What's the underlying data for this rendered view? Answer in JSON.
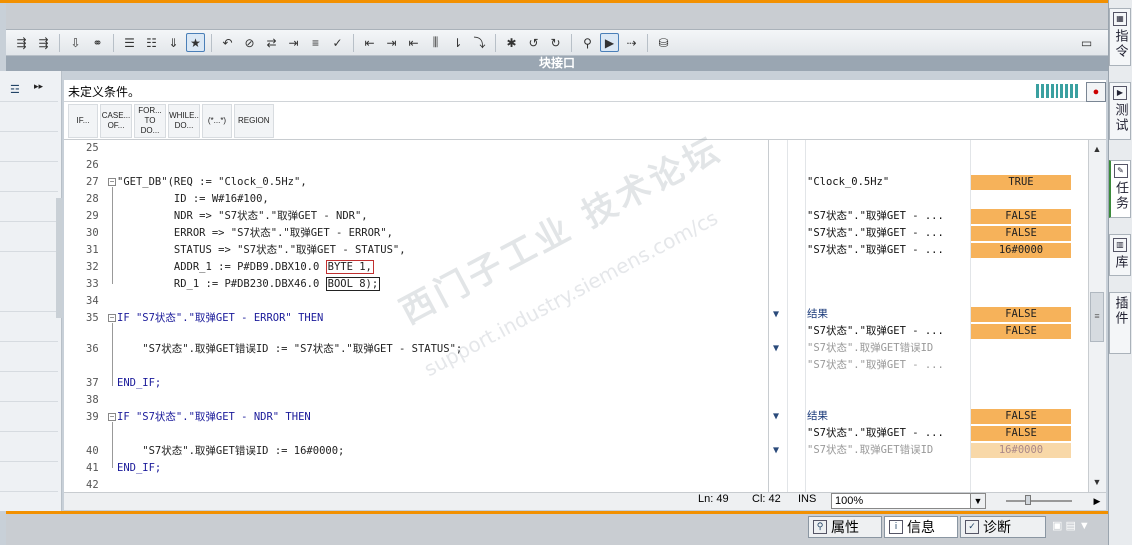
{
  "panel_title": "块接口",
  "condition_text": "未定义条件。",
  "snippets": [
    "IF...",
    "CASE... OF...",
    "FOR... TO DO...",
    "WHILE.. DO...",
    "(*...*)",
    "REGION"
  ],
  "code_lines": [
    {
      "num": "25",
      "text": ""
    },
    {
      "num": "26",
      "text": ""
    },
    {
      "num": "27",
      "text": "\"GET_DB\"(REQ := \"Clock_0.5Hz\","
    },
    {
      "num": "28",
      "text": "         ID := W#16#100,"
    },
    {
      "num": "29",
      "text": "         NDR => \"S7状态\".\"取弹GET - NDR\","
    },
    {
      "num": "30",
      "text": "         ERROR => \"S7状态\".\"取弹GET - ERROR\","
    },
    {
      "num": "31",
      "text": "         STATUS => \"S7状态\".\"取弹GET - STATUS\","
    },
    {
      "num": "32",
      "text": "         ADDR_1 := P#DB9.DBX10.0 "
    },
    {
      "num": "33",
      "text": "         RD_1 := P#DB230.DBX46.0 "
    },
    {
      "num": "34",
      "text": ""
    },
    {
      "num": "35",
      "text": "IF \"S7状态\".\"取弹GET - ERROR\" THEN"
    },
    {
      "num": "36",
      "text": "    \"S7状态\".取弹GET错误ID := \"S7状态\".\"取弹GET - STATUS\";"
    },
    {
      "num": "37",
      "text": "END_IF;"
    },
    {
      "num": "38",
      "text": ""
    },
    {
      "num": "39",
      "text": "IF \"S7状态\".\"取弹GET - NDR\" THEN"
    },
    {
      "num": "40",
      "text": "    \"S7状态\".取弹GET错误ID := 16#0000;"
    },
    {
      "num": "41",
      "text": "END_IF;"
    },
    {
      "num": "42",
      "text": ""
    }
  ],
  "boxed": {
    "addr_type": "BYTE 1,",
    "rd_type": "BOOL 8);"
  },
  "monitor": [
    {
      "name": "\"Clock_0.5Hz\"",
      "value": "TRUE"
    },
    {
      "name": "\"S7状态\".\"取弹GET - ...",
      "value": "FALSE"
    },
    {
      "name": "\"S7状态\".\"取弹GET - ...",
      "value": "FALSE"
    },
    {
      "name": "\"S7状态\".\"取弹GET - ...",
      "value": "16#0000"
    },
    {
      "name": "结果",
      "value": "FALSE"
    },
    {
      "name": "\"S7状态\".\"取弹GET - ...",
      "value": "FALSE"
    },
    {
      "name": "\"S7状态\".取弹GET错误ID",
      "value": ""
    },
    {
      "name": "\"S7状态\".\"取弹GET - ...",
      "value": ""
    },
    {
      "name": "结果",
      "value": "FALSE"
    },
    {
      "name": "\"S7状态\".\"取弹GET - ...",
      "value": "FALSE"
    },
    {
      "name": "\"S7状态\".取弹GET错误ID",
      "value": "16#0000"
    }
  ],
  "status": {
    "ln": "Ln: 49",
    "cl": "Cl: 42",
    "ins": "INS",
    "zoom": "100%"
  },
  "bottom_tabs": [
    "属性",
    "信息",
    "诊断"
  ],
  "right_tabs": [
    "指令",
    "测试",
    "任务",
    "库",
    "插件"
  ],
  "watermark": {
    "cn": "西门子工业 技术论坛",
    "en": "support.industry.siemens.com/cs"
  },
  "colors": {
    "accent": "#f29000",
    "monitor_value": "#f6b25a",
    "keyword": "#1a1a9a"
  }
}
